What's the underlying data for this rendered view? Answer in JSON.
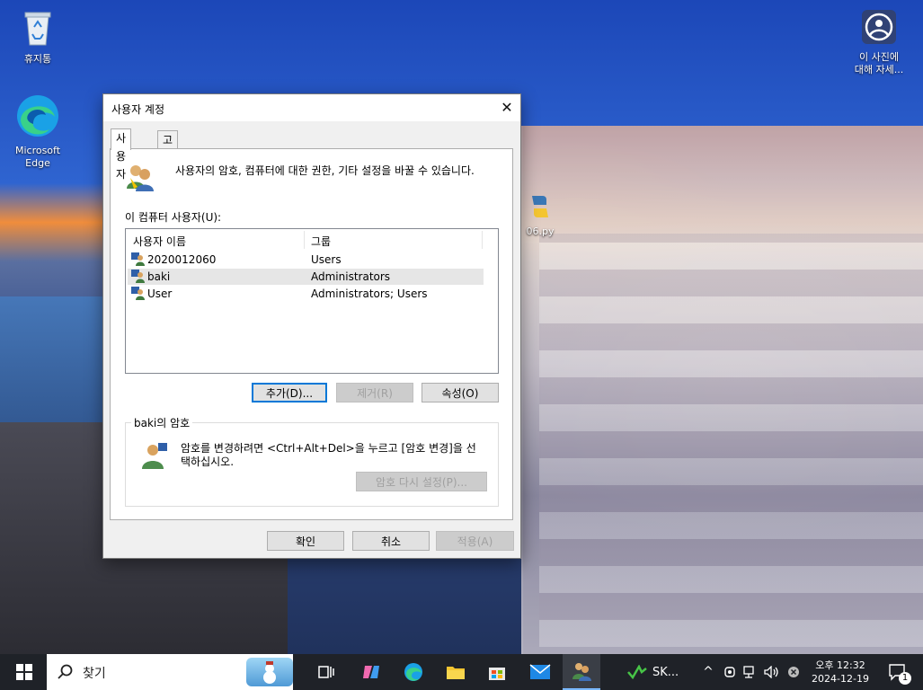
{
  "desktop": {
    "icons": [
      {
        "label": "휴지통"
      },
      {
        "label_line1": "Microsoft",
        "label_line2": "Edge"
      },
      {
        "label_line1": "이 사진에",
        "label_line2": "대해 자세..."
      },
      {
        "label": "06.py"
      }
    ]
  },
  "dialog": {
    "title": "사용자 계정",
    "close_glyph": "✕",
    "tabs": [
      {
        "label": "사용자"
      },
      {
        "label": "고급"
      }
    ],
    "intro_text": "사용자의 암호, 컴퓨터에 대한 권한, 기타 설정을 바꿀 수 있습니다.",
    "users_label": "이 컴퓨터 사용자(U):",
    "columns": [
      "사용자 이름",
      "그룹"
    ],
    "users": [
      {
        "name": "2020012060",
        "group": "Users"
      },
      {
        "name": "baki",
        "group": "Administrators"
      },
      {
        "name": "User",
        "group": "Administrators; Users"
      }
    ],
    "selected_user": "baki",
    "buttons": {
      "add": "추가(D)...",
      "remove": "제거(R)",
      "properties": "속성(O)"
    },
    "password_group": {
      "title": "baki의 암호",
      "text_line1": "암호를 변경하려면 <Ctrl+Alt+Del>을 누르고 [암호 변경]을 선",
      "text_line2": "택하십시오.",
      "reset_button": "암호 다시 설정(P)..."
    },
    "footer": {
      "ok": "확인",
      "cancel": "취소",
      "apply": "적용(A)"
    }
  },
  "taskbar": {
    "search_placeholder": "찾기",
    "running_app_label": "SK...",
    "tray": {
      "chevron": "^",
      "time": "오후 12:32",
      "date": "2024-12-19",
      "notification_count": "1"
    }
  }
}
